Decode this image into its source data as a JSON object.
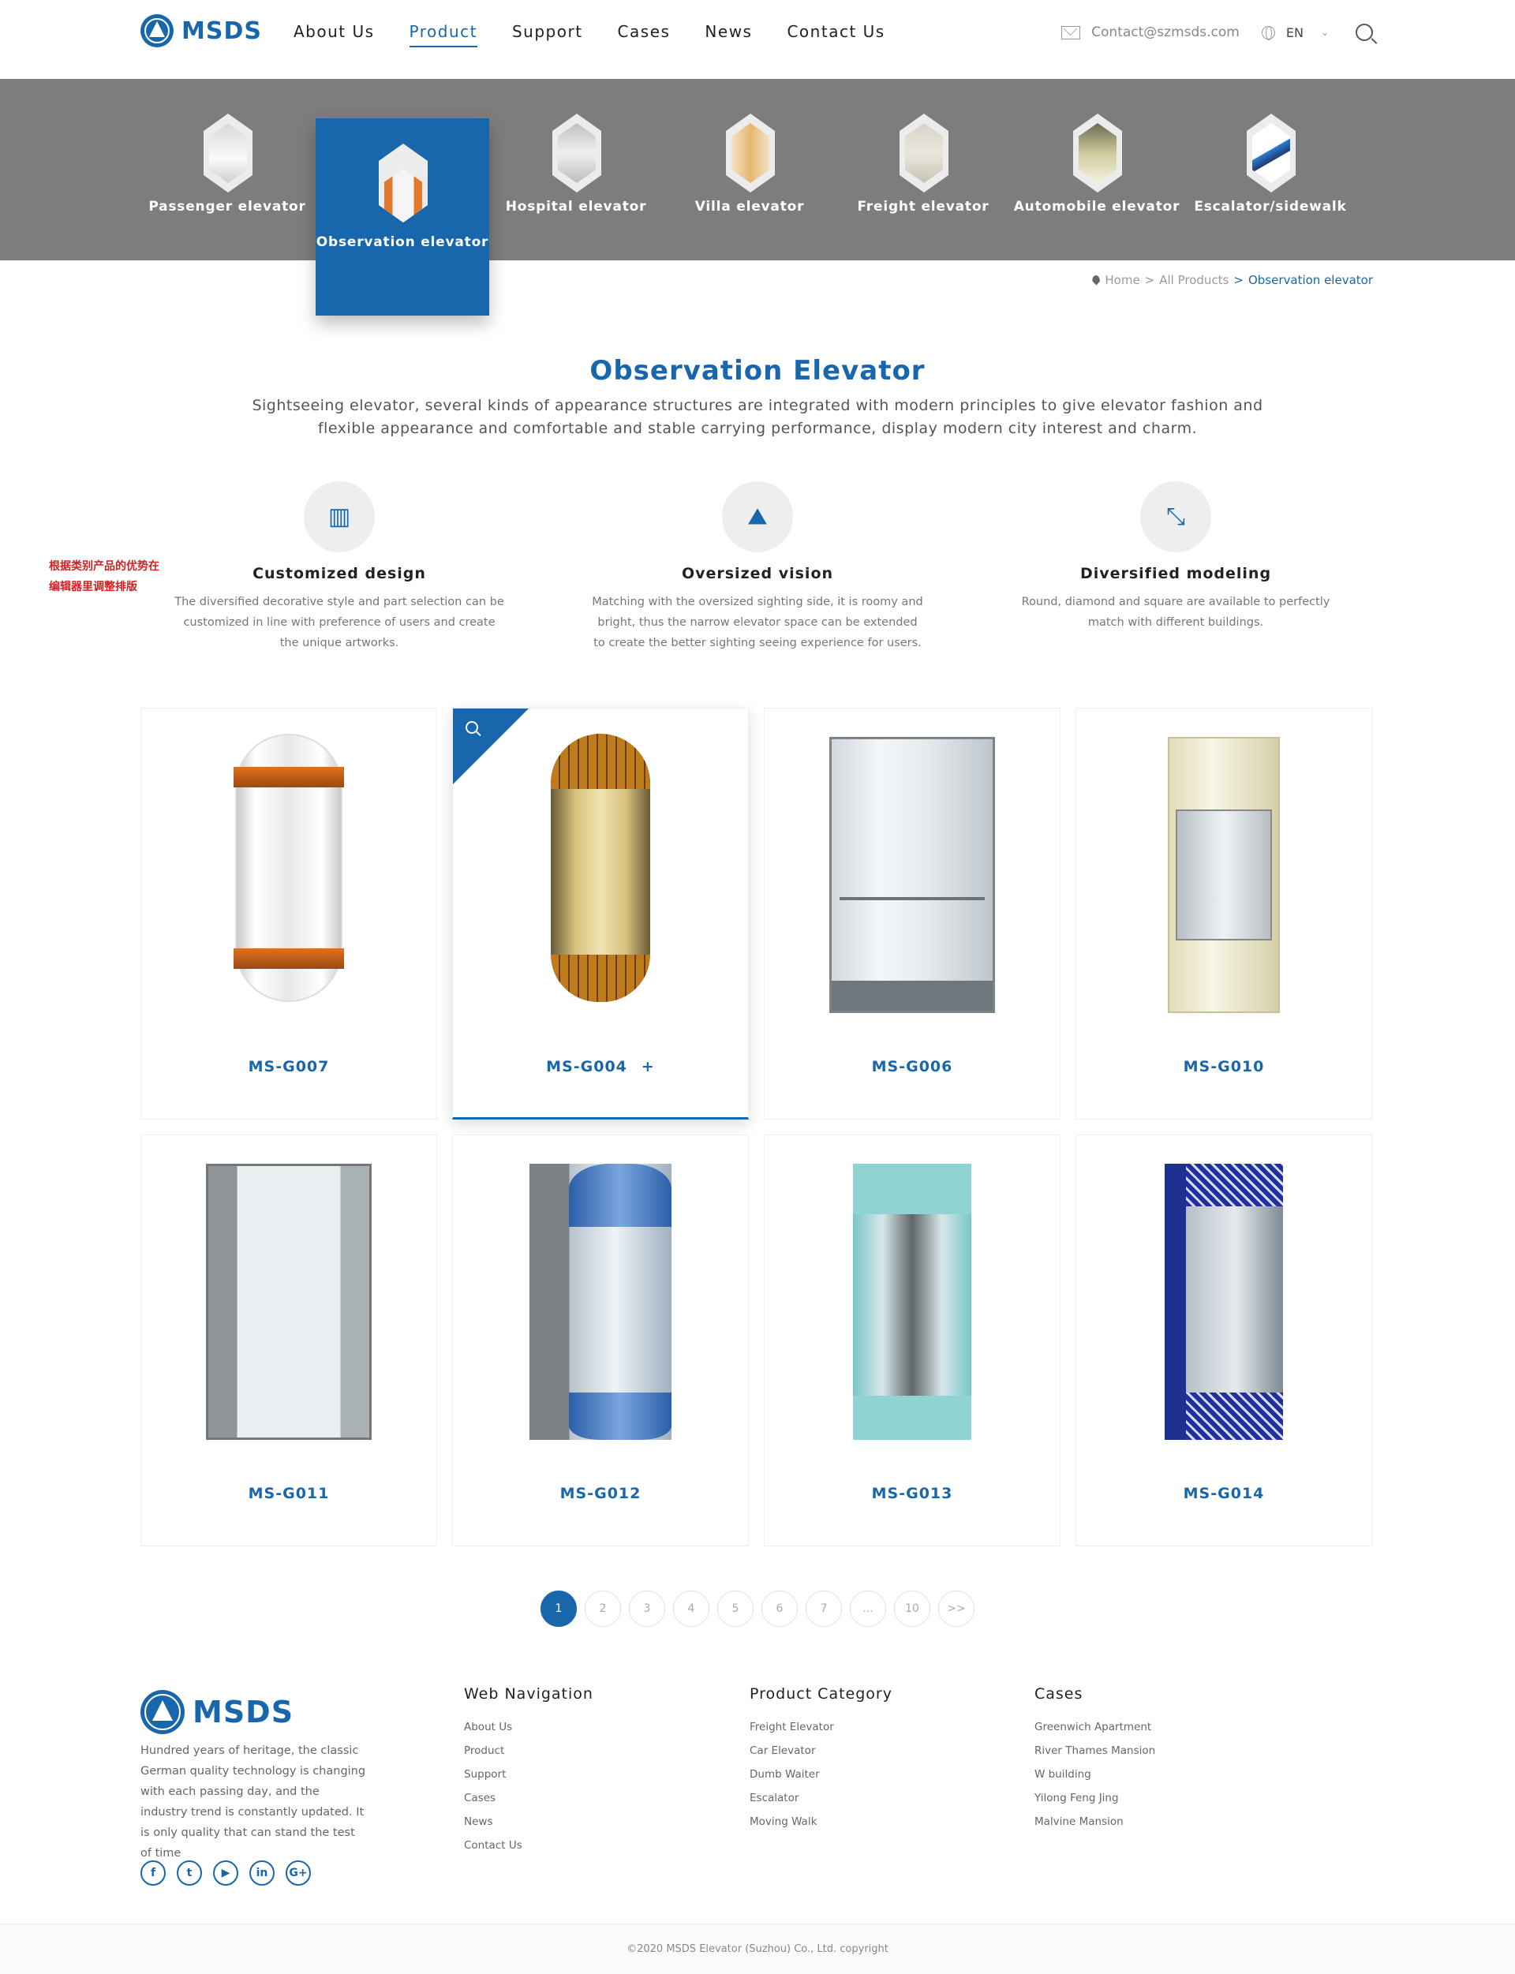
{
  "brand": {
    "name": "MSDS"
  },
  "nav": {
    "items": [
      {
        "label": "About Us",
        "active": false
      },
      {
        "label": "Product",
        "active": true
      },
      {
        "label": "Support",
        "active": false
      },
      {
        "label": "Cases",
        "active": false
      },
      {
        "label": "News",
        "active": false
      },
      {
        "label": "Contact Us",
        "active": false
      }
    ]
  },
  "header": {
    "email": "Contact@szmsds.com",
    "language": "EN"
  },
  "categories": [
    {
      "label": "Passenger elevator",
      "active": false
    },
    {
      "label": "Observation elevator",
      "active": true
    },
    {
      "label": "Hospital elevator",
      "active": false
    },
    {
      "label": "Villa elevator",
      "active": false
    },
    {
      "label": "Freight elevator",
      "active": false
    },
    {
      "label": "Automobile elevator",
      "active": false
    },
    {
      "label": "Escalator/sidewalk",
      "active": false
    }
  ],
  "breadcrumb": {
    "home": "Home",
    "sep1": ">",
    "all": "All Products",
    "sep2": ">",
    "current": "Observation elevator"
  },
  "intro": {
    "title": "Observation Elevator",
    "text": "Sightseeing elevator, several kinds of appearance structures are integrated with modern principles to give elevator fashion and flexible appearance and comfortable and stable carrying performance, display modern city interest and charm."
  },
  "side_note": "根据类别产品的优势在编辑器里调整排版",
  "features": [
    {
      "icon": "ruler-pencil-icon",
      "title": "Customized design",
      "desc": "The diversified decorative style and part selection can be customized in line with preference of users and create the unique artworks."
    },
    {
      "icon": "landscape-icon",
      "title": "Oversized vision",
      "desc": "Matching with the oversized sighting side, it is roomy and bright, thus the narrow elevator space can be extended to create the better sighting seeing experience for users."
    },
    {
      "icon": "expand-arrows-icon",
      "title": "Diversified modeling",
      "desc": "Round, diamond and square are available to perfectly match with different buildings."
    }
  ],
  "products": [
    {
      "model": "MS-G007"
    },
    {
      "model": "MS-G004",
      "plus": "+"
    },
    {
      "model": "MS-G006"
    },
    {
      "model": "MS-G010"
    },
    {
      "model": "MS-G011"
    },
    {
      "model": "MS-G012"
    },
    {
      "model": "MS-G013"
    },
    {
      "model": "MS-G014"
    }
  ],
  "pagination": {
    "pages": [
      "1",
      "2",
      "3",
      "4",
      "5",
      "6",
      "7",
      "...",
      "10",
      ">>"
    ],
    "current": "1"
  },
  "footer": {
    "about": "Hundred years of heritage, the classic German quality technology is changing with each passing day, and the industry trend is constantly updated. It is only quality that can stand the test of time",
    "social": [
      "f",
      "t",
      "▶",
      "in",
      "G+"
    ],
    "columns": [
      {
        "title": "Web Navigation",
        "items": [
          "About Us",
          "Product",
          "Support",
          "Cases",
          "News",
          "Contact Us"
        ]
      },
      {
        "title": "Product Category",
        "items": [
          "Freight Elevator",
          "Car Elevator",
          "Dumb Waiter",
          "Escalator",
          "Moving Walk"
        ]
      },
      {
        "title": "Cases",
        "items": [
          "Greenwich Apartment",
          "River Thames Mansion",
          "W building",
          "Yilong Feng Jing",
          "Malvine Mansion"
        ]
      }
    ],
    "copyright": "©2020 MSDS Elevator (Suzhou) Co., Ltd. copyright"
  },
  "colors": {
    "brand_blue": "#1867ad",
    "category_bar": "#7d7d7d",
    "note_red": "#d02222"
  }
}
